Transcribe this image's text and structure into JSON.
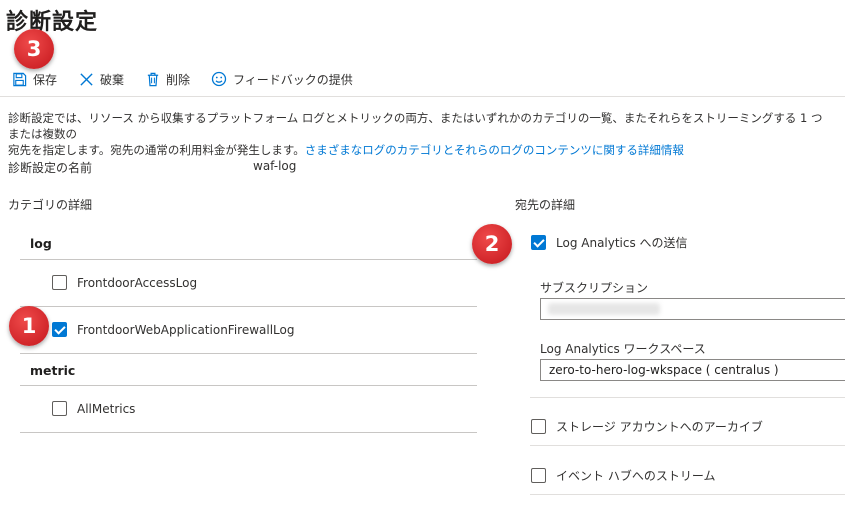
{
  "page_title": "診断設定",
  "toolbar": {
    "save": "保存",
    "discard": "破棄",
    "delete": "削除",
    "feedback": "フィードバックの提供"
  },
  "description": {
    "line1": "診断設定では、リソース から収集するプラットフォーム ログとメトリックの両方、またはいずれかのカテゴリの一覧、またそれらをストリーミングする 1 つまたは複数の",
    "line2_text": "宛先を指定します。宛先の通常の利用料金が発生します。",
    "line2_link": "さまざまなログのカテゴリとそれらのログのコンテンツに関する詳細情報"
  },
  "setting_name": {
    "label": "診断設定の名前",
    "value": "waf-log"
  },
  "categories": {
    "heading": "カテゴリの詳細",
    "log_group": "log",
    "log_items": [
      {
        "label": "FrontdoorAccessLog",
        "checked": false
      },
      {
        "label": "FrontdoorWebApplicationFirewallLog",
        "checked": true
      }
    ],
    "metric_group": "metric",
    "metric_items": [
      {
        "label": "AllMetrics",
        "checked": false
      }
    ]
  },
  "destinations": {
    "heading": "宛先の詳細",
    "log_analytics": {
      "label": "Log Analytics への送信",
      "checked": true
    },
    "subscription_label": "サブスクリプション",
    "workspace_label": "Log Analytics ワークスペース",
    "workspace_value": "zero-to-hero-log-wkspace ( centralus )",
    "storage": {
      "label": "ストレージ アカウントへのアーカイブ",
      "checked": false
    },
    "eventhub": {
      "label": "イベント ハブへのストリーム",
      "checked": false
    }
  },
  "annotations": [
    "3",
    "1",
    "2"
  ],
  "colors": {
    "accent": "#0078d4",
    "badge": "#d9262c"
  }
}
